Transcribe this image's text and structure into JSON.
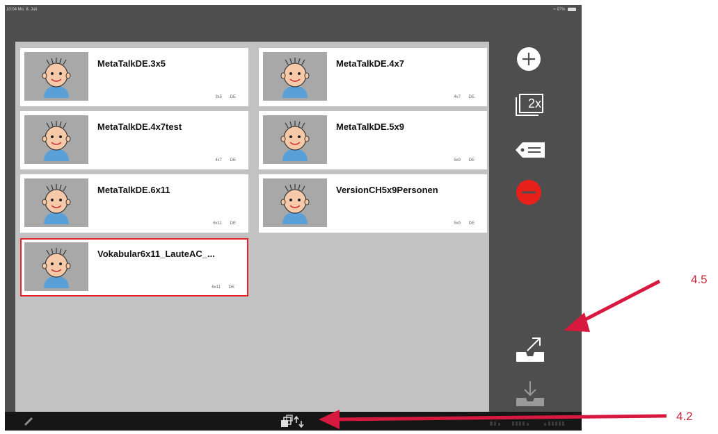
{
  "statusbar": {
    "time": "10:04  Mo. 8. Juli",
    "battery": "97%"
  },
  "vocabularies": [
    {
      "title": "MetaTalkDE.3x5",
      "size": "3x5",
      "lang": "DE",
      "selected": false
    },
    {
      "title": "MetaTalkDE.4x7",
      "size": "4x7",
      "lang": "DE",
      "selected": false
    },
    {
      "title": "MetaTalkDE.4x7test",
      "size": "4x7",
      "lang": "DE",
      "selected": false
    },
    {
      "title": "MetaTalkDE.5x9",
      "size": "5x9",
      "lang": "DE",
      "selected": false
    },
    {
      "title": "MetaTalkDE.6x11",
      "size": "6x11",
      "lang": "DE",
      "selected": false
    },
    {
      "title": "VersionCH5x9Personen",
      "size": "5x9",
      "lang": "DE",
      "selected": false
    },
    {
      "title": "Vokabular6x11_LauteAC_...",
      "size": "6x11",
      "lang": "DE",
      "selected": true
    }
  ],
  "sidebar": {
    "duplicate_label": "2x",
    "icons": [
      "add-icon",
      "duplicate-icon",
      "rename-tag-icon",
      "delete-icon",
      "export-icon",
      "import-icon"
    ]
  },
  "annotations": {
    "export_label": "4.5",
    "switch_label": "4.2",
    "arrow_color": "#d7193f"
  },
  "colors": {
    "delete": "#e8201b",
    "selected_border": "#e8202a",
    "panel": "#4e4e4e",
    "content_bg": "#c2c2c2"
  }
}
